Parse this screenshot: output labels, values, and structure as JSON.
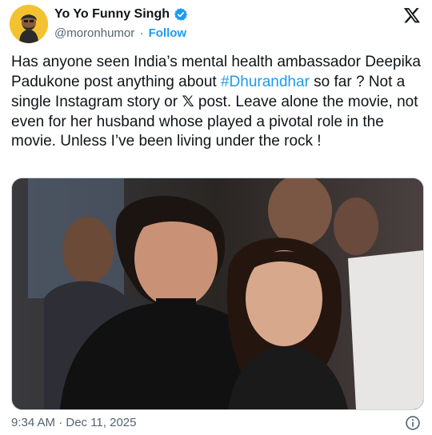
{
  "author": {
    "display_name": "Yo Yo Funny Singh",
    "handle": "@moronhumor",
    "separator": "·",
    "follow_label": "Follow",
    "verified_color": "#1d9bf0",
    "avatar_bg": "#f2c230"
  },
  "tweet": {
    "text_part1": "Has anyone seen India’s mental health ambassador Deepika Padukone post anything about ",
    "hashtag": "#Dhurandhar",
    "text_part2": " so far ? Not a single Instagram story or ",
    "x_glyph": "𝕏",
    "text_part3": " post. Leave alone the movie, not even for her husband whose played a pivotal role in the movie. Unless I’ve been living under the rock !",
    "timestamp": "9:34 AM · Dec 11, 2025"
  },
  "icons": {
    "logo": "x-logo-icon",
    "info": "info-icon",
    "verified": "verified-badge-icon"
  },
  "colors": {
    "link": "#1d9bf0",
    "text": "#0f1419",
    "secondary": "#536471"
  }
}
